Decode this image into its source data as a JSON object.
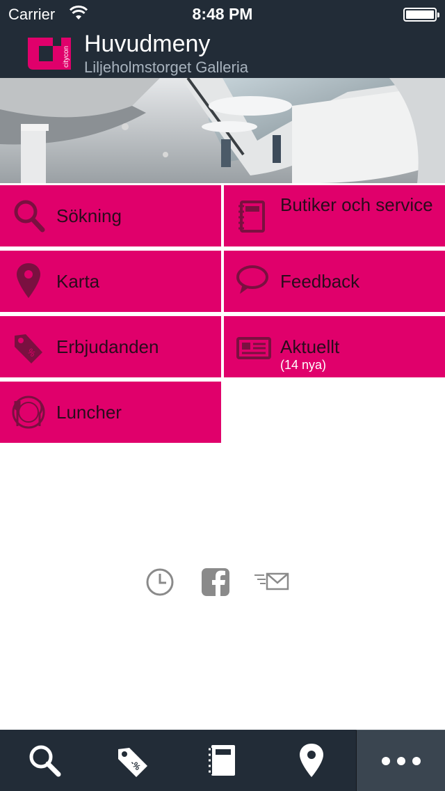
{
  "status_bar": {
    "carrier": "Carrier",
    "time": "8:48 PM"
  },
  "header": {
    "title": "Huvudmeny",
    "subtitle": "Liljeholmstorget Galleria",
    "logo_text": "citycon"
  },
  "hero": {
    "icon": "mall-interior-photo"
  },
  "menu": {
    "tiles": [
      {
        "label": "Sökning",
        "icon": "search-icon"
      },
      {
        "label": "Butiker och service",
        "icon": "notebook-icon"
      },
      {
        "label": "Karta",
        "icon": "map-pin-icon"
      },
      {
        "label": "Feedback",
        "icon": "speech-bubble-icon"
      },
      {
        "label": "Erbjudanden",
        "icon": "price-tag-icon"
      },
      {
        "label": "Aktuellt",
        "sublabel": "(14 nya)",
        "icon": "newspaper-icon"
      },
      {
        "label": "Luncher",
        "icon": "plate-cutlery-icon"
      }
    ]
  },
  "footer_links": [
    {
      "icon": "clock-icon"
    },
    {
      "icon": "facebook-icon"
    },
    {
      "icon": "newsletter-mail-icon"
    }
  ],
  "tab_bar": {
    "tabs": [
      {
        "icon": "search-icon"
      },
      {
        "icon": "discount-tag-icon",
        "text": "-%"
      },
      {
        "icon": "notebook-icon"
      },
      {
        "icon": "map-pin-icon"
      },
      {
        "icon": "more-dots-icon",
        "active": true
      }
    ]
  },
  "colors": {
    "bar_background": "#222c37",
    "tile_background": "#e0006b",
    "tile_icon": "#7a1040",
    "subtitle": "#a8b3be",
    "social_icon": "#8a8a8a"
  }
}
